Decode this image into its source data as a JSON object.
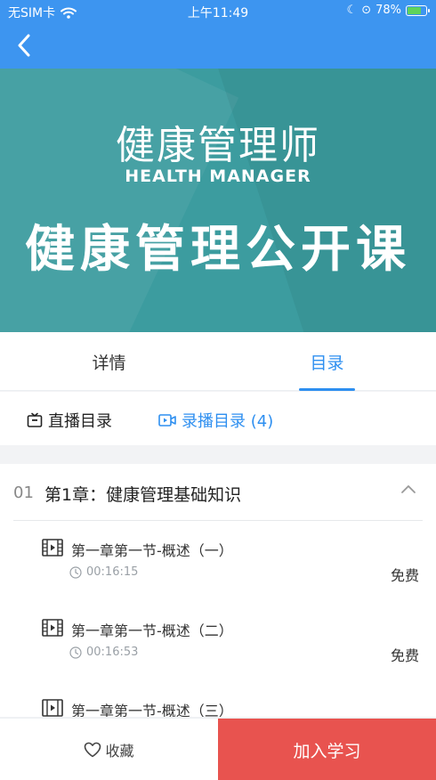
{
  "status_bar": {
    "carrier": "无SIM卡",
    "time": "上午11:49",
    "battery": "78%",
    "battery_level": 0.78
  },
  "banner": {
    "title_cn": "健康管理师",
    "title_en": "HEALTH MANAGER",
    "title_big": "健康管理公开课"
  },
  "tabs": {
    "detail": "详情",
    "catalog": "目录"
  },
  "subtabs": {
    "live": "直播目录",
    "recorded": "录播目录 (4)"
  },
  "chapter": {
    "number": "01",
    "title": "第1章：健康管理基础知识"
  },
  "lessons": [
    {
      "title": "第一章第一节-概述（一）",
      "duration": "00:16:15",
      "price": "免费"
    },
    {
      "title": "第一章第一节-概述（二）",
      "duration": "00:16:53",
      "price": "免费"
    },
    {
      "title": "第一章第一节-概述（三）",
      "duration": "",
      "price": ""
    }
  ],
  "bottom": {
    "favorite": "收藏",
    "join": "加入学习"
  },
  "colors": {
    "primary": "#3d95f0",
    "accent_blue": "#2e8ff0",
    "banner_bg": "#3c9c9f",
    "join_red": "#e8534f"
  }
}
